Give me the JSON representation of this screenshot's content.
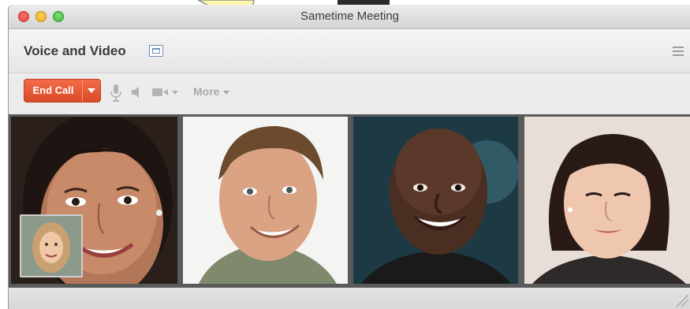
{
  "window": {
    "title": "Sametime Meeting"
  },
  "header": {
    "title": "Voice and Video"
  },
  "toolbar": {
    "end_call_label": "End Call",
    "more_label": "More"
  },
  "participants": [
    {
      "id": "participant-1"
    },
    {
      "id": "participant-2"
    },
    {
      "id": "participant-3"
    },
    {
      "id": "participant-4"
    }
  ],
  "icons": {
    "popout": "popout-icon",
    "menu": "menu-icon",
    "mic": "microphone-icon",
    "speaker": "speaker-icon",
    "camera": "video-camera-icon"
  },
  "colors": {
    "end_call": "#e2532f",
    "close": "#e0443e",
    "minimize": "#e8a826",
    "zoom": "#3fb73a"
  }
}
